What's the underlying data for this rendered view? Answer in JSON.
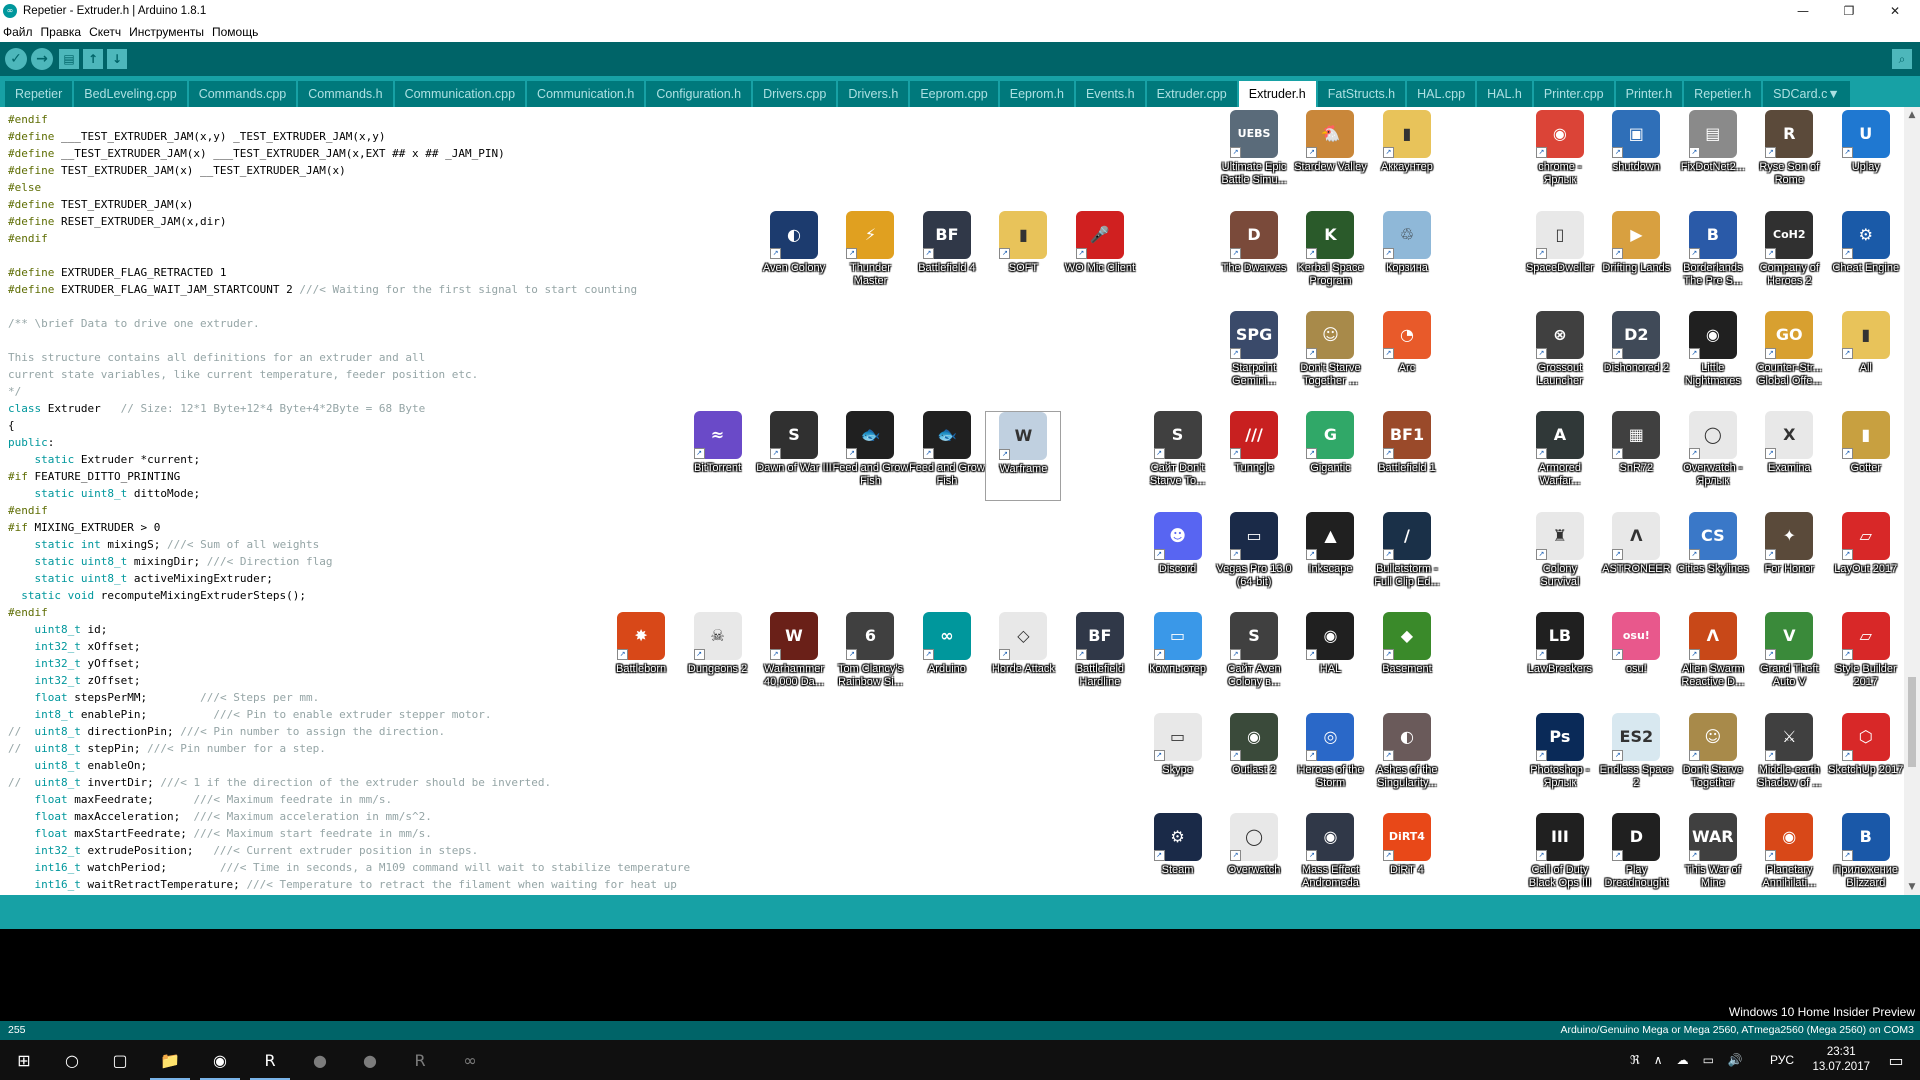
{
  "window": {
    "title": "Repetier - Extruder.h | Arduino 1.8.1",
    "app_icon": "∞",
    "controls": [
      "—",
      "❐",
      "✕"
    ]
  },
  "menu": [
    "Файл",
    "Правка",
    "Скетч",
    "Инструменты",
    "Помощь"
  ],
  "toolbar": {
    "verify_icon": "✓",
    "upload_icon": "→",
    "new_icon": "▤",
    "open_icon": "↑",
    "save_icon": "↓",
    "serial_icon": "⌕"
  },
  "tabs": [
    {
      "label": "Repetier"
    },
    {
      "label": "BedLeveling.cpp"
    },
    {
      "label": "Commands.cpp"
    },
    {
      "label": "Commands.h"
    },
    {
      "label": "Communication.cpp"
    },
    {
      "label": "Communication.h"
    },
    {
      "label": "Configuration.h"
    },
    {
      "label": "Drivers.cpp"
    },
    {
      "label": "Drivers.h"
    },
    {
      "label": "Eeprom.cpp"
    },
    {
      "label": "Eeprom.h"
    },
    {
      "label": "Events.h"
    },
    {
      "label": "Extruder.cpp"
    },
    {
      "label": "Extruder.h",
      "active": true
    },
    {
      "label": "FatStructs.h"
    },
    {
      "label": "HAL.cpp"
    },
    {
      "label": "HAL.h"
    },
    {
      "label": "Printer.cpp"
    },
    {
      "label": "Printer.h"
    },
    {
      "label": "Repetier.h"
    },
    {
      "label": "SDCard.c▼"
    }
  ],
  "code_lines": [
    "#endif",
    "#define ___TEST_EXTRUDER_JAM(x,y) _TEST_EXTRUDER_JAM(x,y)",
    "#define __TEST_EXTRUDER_JAM(x) ___TEST_EXTRUDER_JAM(x,EXT ## x ## _JAM_PIN)",
    "#define TEST_EXTRUDER_JAM(x) __TEST_EXTRUDER_JAM(x)",
    "#else",
    "#define TEST_EXTRUDER_JAM(x)",
    "#define RESET_EXTRUDER_JAM(x,dir)",
    "#endif",
    "",
    "#define EXTRUDER_FLAG_RETRACTED 1",
    "#define EXTRUDER_FLAG_WAIT_JAM_STARTCOUNT 2 ///< Waiting for the first signal to start counting",
    "",
    "/** \\brief Data to drive one extruder.",
    "",
    "This structure contains all definitions for an extruder and all",
    "current state variables, like current temperature, feeder position etc.",
    "*/",
    "class Extruder   // Size: 12*1 Byte+12*4 Byte+4*2Byte = 68 Byte",
    "{",
    "public:",
    "    static Extruder *current;",
    "#if FEATURE_DITTO_PRINTING",
    "    static uint8_t dittoMode;",
    "#endif",
    "#if MIXING_EXTRUDER > 0",
    "    static int mixingS; ///< Sum of all weights",
    "    static uint8_t mixingDir; ///< Direction flag",
    "    static uint8_t activeMixingExtruder;",
    "  static void recomputeMixingExtruderSteps();",
    "#endif",
    "    uint8_t id;",
    "    int32_t xOffset;",
    "    int32_t yOffset;",
    "    int32_t zOffset;",
    "    float stepsPerMM;        ///< Steps per mm.",
    "    int8_t enablePin;          ///< Pin to enable extruder stepper motor.",
    "//  uint8_t directionPin; ///< Pin number to assign the direction.",
    "//  uint8_t stepPin; ///< Pin number for a step.",
    "    uint8_t enableOn;",
    "//  uint8_t invertDir; ///< 1 if the direction of the extruder should be inverted.",
    "    float maxFeedrate;      ///< Maximum feedrate in mm/s.",
    "    float maxAcceleration;  ///< Maximum acceleration in mm/s^2.",
    "    float maxStartFeedrate; ///< Maximum start feedrate in mm/s.",
    "    int32_t extrudePosition;   ///< Current extruder position in steps.",
    "    int16_t watchPeriod;        ///< Time in seconds, a M109 command will wait to stabilize temperature",
    "    int16_t waitRetractTemperature; ///< Temperature to retract the filament when waiting for heat up"
  ],
  "desktop_icons": [
    {
      "label": "Ultimate Epic Battle Simu...",
      "color": "#5a6b7a",
      "glyph": "UEBS"
    },
    {
      "label": "Stardew Valley",
      "color": "#c9873a",
      "glyph": "🐔"
    },
    {
      "label": "Аккаунтер",
      "color": "#e8c35a",
      "glyph": "▮"
    },
    {
      "label": "chrome - Ярлык",
      "color": "#db4437",
      "glyph": "◉"
    },
    {
      "label": "shutdown",
      "color": "#2f6fb8",
      "glyph": "▣"
    },
    {
      "label": "FixDotNet2...",
      "color": "#8a8a8a",
      "glyph": "▤"
    },
    {
      "label": "Ryse Son of Rome",
      "color": "#5b4a3a",
      "glyph": "R"
    },
    {
      "label": "Uplay",
      "color": "#1f78d1",
      "glyph": "U"
    },
    {
      "label": "Aven Colony",
      "color": "#1c3b6e",
      "glyph": "◐"
    },
    {
      "label": "Thunder Master",
      "color": "#e0a020",
      "glyph": "⚡"
    },
    {
      "label": "Battlefield 4",
      "color": "#303848",
      "glyph": "BF"
    },
    {
      "label": "SOFT",
      "color": "#e8c35a",
      "glyph": "▮"
    },
    {
      "label": "WO Mic Client",
      "color": "#d02020",
      "glyph": "🎤"
    },
    {
      "label": "The Dwarves",
      "color": "#7a4a3a",
      "glyph": "D"
    },
    {
      "label": "Kerbal Space Program",
      "color": "#2a5a2a",
      "glyph": "K"
    },
    {
      "label": "Корзина",
      "color": "#8fb8d8",
      "glyph": "♲"
    },
    {
      "label": "SpaceDweller",
      "color": "#e8e8e8",
      "glyph": "▯"
    },
    {
      "label": "Drifting Lands",
      "color": "#d8a040",
      "glyph": "▶"
    },
    {
      "label": "Borderlands The Pre S...",
      "color": "#2a5aa8",
      "glyph": "B"
    },
    {
      "label": "Company of Heroes 2",
      "color": "#303030",
      "glyph": "CoH2"
    },
    {
      "label": "Cheat Engine",
      "color": "#1a5aa8",
      "glyph": "⚙"
    },
    {
      "label": "Starpoint Gemini...",
      "color": "#3a4a6a",
      "glyph": "SPG"
    },
    {
      "label": "Don't Starve Together ...",
      "color": "#a88a4a",
      "glyph": "☺"
    },
    {
      "label": "Arc",
      "color": "#e85a2a",
      "glyph": "◔"
    },
    {
      "label": "Grossout Launcher",
      "color": "#404040",
      "glyph": "⊗"
    },
    {
      "label": "Dishonored 2",
      "color": "#404a58",
      "glyph": "D2"
    },
    {
      "label": "Little Nightmares",
      "color": "#202020",
      "glyph": "◉"
    },
    {
      "label": "Counter-Str... Global Offe...",
      "color": "#d8a030",
      "glyph": "GO"
    },
    {
      "label": "All",
      "color": "#e8c35a",
      "glyph": "▮"
    },
    {
      "label": "BitTorrent",
      "color": "#6a4ac8",
      "glyph": "≈"
    },
    {
      "label": "Dawn of War III",
      "color": "#303030",
      "glyph": "S"
    },
    {
      "label": "Feed and Grow Fish",
      "color": "#202020",
      "glyph": "🐟"
    },
    {
      "label": "Feed and Grow Fish",
      "color": "#202020",
      "glyph": "🐟"
    },
    {
      "label": "Warframe",
      "color": "#c0d0e0",
      "glyph": "W"
    },
    {
      "label": "Сайт Don't Starve To...",
      "color": "#404040",
      "glyph": "S"
    },
    {
      "label": "Tunngle",
      "color": "#c82020",
      "glyph": "///"
    },
    {
      "label": "Gigantic",
      "color": "#30a868",
      "glyph": "G"
    },
    {
      "label": "Battlefield 1",
      "color": "#9a4a2a",
      "glyph": "BF1"
    },
    {
      "label": "Armored Warfar...",
      "color": "#303838",
      "glyph": "A"
    },
    {
      "label": "SnR72",
      "color": "#404040",
      "glyph": "▦"
    },
    {
      "label": "Overwatch - Ярлык",
      "color": "#e8e8e8",
      "glyph": "◯"
    },
    {
      "label": "Examina",
      "color": "#e8e8e8",
      "glyph": "X"
    },
    {
      "label": "Gotter",
      "color": "#c8a040",
      "glyph": "▮"
    },
    {
      "label": "Discord",
      "color": "#5865f2",
      "glyph": "☻"
    },
    {
      "label": "Vegas Pro 13.0 (64-bit)",
      "color": "#1a2a48",
      "glyph": "▭"
    },
    {
      "label": "Inkscape",
      "color": "#202020",
      "glyph": "▲"
    },
    {
      "label": "Bulletstorm - Full Clip Ed...",
      "color": "#1a3048",
      "glyph": "/"
    },
    {
      "label": "Colony Survival",
      "color": "#e8e8e8",
      "glyph": "♜"
    },
    {
      "label": "ASTRONEER",
      "color": "#e8e8e8",
      "glyph": "Λ"
    },
    {
      "label": "Cities Skylines",
      "color": "#3a78c8",
      "glyph": "CS"
    },
    {
      "label": "For Honor",
      "color": "#5a4a3a",
      "glyph": "✦"
    },
    {
      "label": "LayOut 2017",
      "color": "#d82828",
      "glyph": "▱"
    },
    {
      "label": "Battleborn",
      "color": "#d84818",
      "glyph": "✸"
    },
    {
      "label": "Dungeons 2",
      "color": "#e8e8e8",
      "glyph": "☠"
    },
    {
      "label": "Warhammer 40,000 Da...",
      "color": "#6a2018",
      "glyph": "W"
    },
    {
      "label": "Tom Clancy's Rainbow Si...",
      "color": "#404040",
      "glyph": "6"
    },
    {
      "label": "Arduino",
      "color": "#00979c",
      "glyph": "∞"
    },
    {
      "label": "Horde Attack",
      "color": "#e8e8e8",
      "glyph": "◇"
    },
    {
      "label": "Battlefield Hardline",
      "color": "#303848",
      "glyph": "BF"
    },
    {
      "label": "Компьютер",
      "color": "#3a98e8",
      "glyph": "▭"
    },
    {
      "label": "Сайт Aven Colony в...",
      "color": "#404040",
      "glyph": "S"
    },
    {
      "label": "HAL",
      "color": "#202020",
      "glyph": "◉"
    },
    {
      "label": "Basement",
      "color": "#3a8a2a",
      "glyph": "◆"
    },
    {
      "label": "LawBreakers",
      "color": "#202020",
      "glyph": "LB"
    },
    {
      "label": "osu!",
      "color": "#e8588c",
      "glyph": "osu!"
    },
    {
      "label": "Alien Swarm Reactive D...",
      "color": "#c84818",
      "glyph": "Λ"
    },
    {
      "label": "Grand Theft Auto V",
      "color": "#3a8a3a",
      "glyph": "V"
    },
    {
      "label": "Style Builder 2017",
      "color": "#d82828",
      "glyph": "▱"
    },
    {
      "label": "Skype",
      "color": "#e8e8e8",
      "glyph": "▭"
    },
    {
      "label": "Outlast 2",
      "color": "#3a4a3a",
      "glyph": "◉"
    },
    {
      "label": "Heroes of the Storm",
      "color": "#2a68c8",
      "glyph": "◎"
    },
    {
      "label": "Ashes of the Singularity...",
      "color": "#6a5a5a",
      "glyph": "◐"
    },
    {
      "label": "Photoshop - Ярлык",
      "color": "#0a2a58",
      "glyph": "Ps"
    },
    {
      "label": "Endless Space 2",
      "color": "#d8e8f0",
      "glyph": "ES2"
    },
    {
      "label": "Don't Starve Together",
      "color": "#a88a4a",
      "glyph": "☺"
    },
    {
      "label": "Middle-earth Shadow of ...",
      "color": "#404040",
      "glyph": "⚔"
    },
    {
      "label": "SketchUp 2017",
      "color": "#d82828",
      "glyph": "⬡"
    },
    {
      "label": "Steam",
      "color": "#1a2a48",
      "glyph": "⚙"
    },
    {
      "label": "Overwatch",
      "color": "#e8e8e8",
      "glyph": "◯"
    },
    {
      "label": "Mass Effect Andromeda",
      "color": "#303848",
      "glyph": "◉"
    },
    {
      "label": "DiRT 4",
      "color": "#e84818",
      "glyph": "DiRT4"
    },
    {
      "label": "Call of Duty Black Ops III",
      "color": "#202020",
      "glyph": "III"
    },
    {
      "label": "Play Dreadnought",
      "color": "#202020",
      "glyph": "D"
    },
    {
      "label": "This War of Mine",
      "color": "#404040",
      "glyph": "WAR"
    },
    {
      "label": "Planetary Annihilati...",
      "color": "#d84818",
      "glyph": "◉"
    },
    {
      "label": "Приложение Blizzard",
      "color": "#1a58a8",
      "glyph": "B"
    }
  ],
  "status": {
    "line": "255",
    "board": "Arduino/Genuino Mega or Mega 2560, ATmega2560 (Mega 2560) on COM3",
    "watermark": "Windows 10 Home Insider Preview"
  },
  "taskbar": {
    "start_icon": "⊞",
    "search_icon": "○",
    "taskview_icon": "▢",
    "apps": [
      "📁",
      "◉",
      "R",
      "●",
      "●",
      "R",
      "∞"
    ],
    "tray_icons": [
      "ℜ",
      "∧",
      "☁",
      "▭",
      "🔊"
    ],
    "lang": "РУС",
    "time": "23:31",
    "date": "13.07.2017",
    "notif_icon": "▭"
  }
}
